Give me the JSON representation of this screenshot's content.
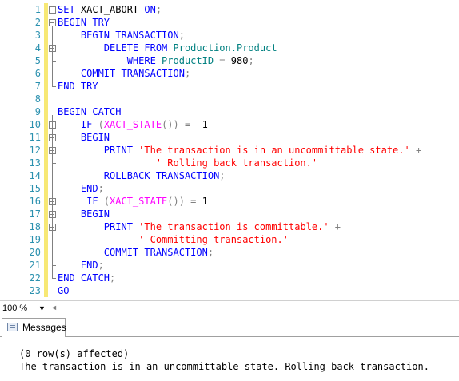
{
  "editor": {
    "lines": [
      {
        "n": "1",
        "tokens": [
          {
            "t": "SET ",
            "c": "kw"
          },
          {
            "t": "XACT_ABORT ",
            "c": "txt"
          },
          {
            "t": "ON",
            "c": "kw"
          },
          {
            "t": ";",
            "c": "gr"
          }
        ]
      },
      {
        "n": "2",
        "tokens": [
          {
            "t": "BEGIN TRY",
            "c": "kw"
          }
        ]
      },
      {
        "n": "3",
        "tokens": [
          {
            "t": "    BEGIN TRANSACTION",
            "c": "kw"
          },
          {
            "t": ";",
            "c": "gr"
          }
        ]
      },
      {
        "n": "4",
        "tokens": [
          {
            "t": "        DELETE FROM ",
            "c": "kw"
          },
          {
            "t": "Production.Product",
            "c": "obj"
          }
        ]
      },
      {
        "n": "5",
        "tokens": [
          {
            "t": "            WHERE ",
            "c": "kw"
          },
          {
            "t": "ProductID ",
            "c": "obj"
          },
          {
            "t": "= ",
            "c": "gr"
          },
          {
            "t": "980",
            "c": "txt"
          },
          {
            "t": ";",
            "c": "gr"
          }
        ]
      },
      {
        "n": "6",
        "tokens": [
          {
            "t": "    COMMIT TRANSACTION",
            "c": "kw"
          },
          {
            "t": ";",
            "c": "gr"
          }
        ]
      },
      {
        "n": "7",
        "tokens": [
          {
            "t": "END TRY",
            "c": "kw"
          }
        ]
      },
      {
        "n": "8",
        "tokens": []
      },
      {
        "n": "9",
        "tokens": [
          {
            "t": "BEGIN CATCH",
            "c": "kw"
          }
        ]
      },
      {
        "n": "10",
        "tokens": [
          {
            "t": "    IF ",
            "c": "kw"
          },
          {
            "t": "(",
            "c": "gr"
          },
          {
            "t": "XACT_STATE",
            "c": "fn"
          },
          {
            "t": "()) = -",
            "c": "gr"
          },
          {
            "t": "1",
            "c": "txt"
          }
        ]
      },
      {
        "n": "11",
        "tokens": [
          {
            "t": "    BEGIN",
            "c": "kw"
          }
        ]
      },
      {
        "n": "12",
        "tokens": [
          {
            "t": "        PRINT ",
            "c": "kw"
          },
          {
            "t": "'The transaction is in an uncommittable state.'",
            "c": "str"
          },
          {
            "t": " +",
            "c": "gr"
          }
        ]
      },
      {
        "n": "13",
        "tokens": [
          {
            "t": "                 ' Rolling back transaction.'",
            "c": "str"
          }
        ]
      },
      {
        "n": "14",
        "tokens": [
          {
            "t": "        ROLLBACK TRANSACTION",
            "c": "kw"
          },
          {
            "t": ";",
            "c": "gr"
          }
        ]
      },
      {
        "n": "15",
        "tokens": [
          {
            "t": "    END",
            "c": "kw"
          },
          {
            "t": ";",
            "c": "gr"
          }
        ]
      },
      {
        "n": "16",
        "tokens": [
          {
            "t": "     IF ",
            "c": "kw"
          },
          {
            "t": "(",
            "c": "gr"
          },
          {
            "t": "XACT_STATE",
            "c": "fn"
          },
          {
            "t": "()) = ",
            "c": "gr"
          },
          {
            "t": "1",
            "c": "txt"
          }
        ]
      },
      {
        "n": "17",
        "tokens": [
          {
            "t": "    BEGIN",
            "c": "kw"
          }
        ]
      },
      {
        "n": "18",
        "tokens": [
          {
            "t": "        PRINT ",
            "c": "kw"
          },
          {
            "t": "'The transaction is committable.'",
            "c": "str"
          },
          {
            "t": " +",
            "c": "gr"
          }
        ]
      },
      {
        "n": "19",
        "tokens": [
          {
            "t": "              ' Committing transaction.'",
            "c": "str"
          }
        ]
      },
      {
        "n": "20",
        "tokens": [
          {
            "t": "        COMMIT TRANSACTION",
            "c": "kw"
          },
          {
            "t": ";",
            "c": "gr"
          }
        ]
      },
      {
        "n": "21",
        "tokens": [
          {
            "t": "    END",
            "c": "kw"
          },
          {
            "t": ";",
            "c": "gr"
          }
        ]
      },
      {
        "n": "22",
        "tokens": [
          {
            "t": "END CATCH",
            "c": "kw"
          },
          {
            "t": ";",
            "c": "gr"
          }
        ]
      },
      {
        "n": "23",
        "tokens": [
          {
            "t": "GO",
            "c": "kw"
          }
        ]
      }
    ],
    "fold_markers": [
      "1",
      "2",
      "4",
      "10",
      "11",
      "12",
      "16",
      "17",
      "18"
    ],
    "colors": {
      "keyword": "#0000ff",
      "string": "#ff0000",
      "function": "#ff00ff",
      "object": "#008080",
      "operator": "#808080",
      "line_number": "#2b91af",
      "change_bar": "#f7e875"
    }
  },
  "statusbar": {
    "zoom": "100 %",
    "zoom_dropdown_icon": "dropdown-arrow",
    "scroll_icon": "scroll-left-arrow"
  },
  "results": {
    "tab_label": "Messages",
    "tab_icon": "messages-icon",
    "output_lines": [
      "(0 row(s) affected)",
      "The transaction is in an uncommittable state. Rolling back transaction."
    ]
  }
}
